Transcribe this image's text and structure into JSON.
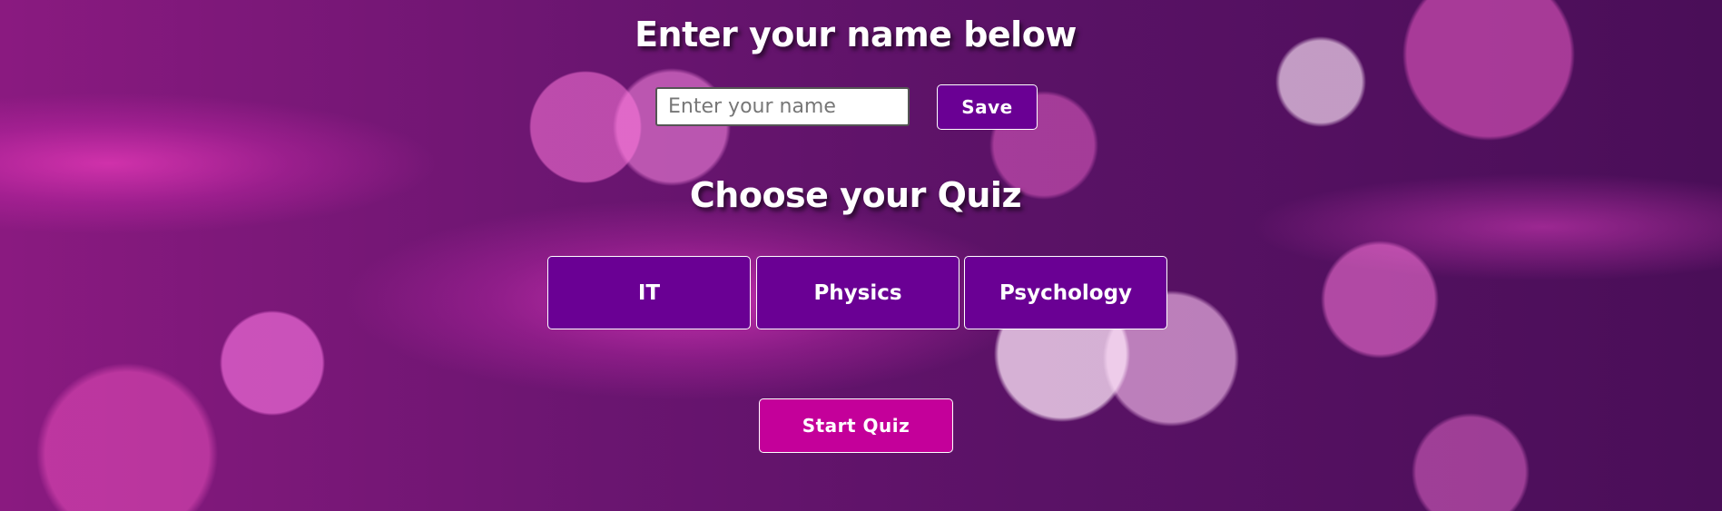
{
  "name_section": {
    "heading": "Enter your name below",
    "input_placeholder": "Enter your name",
    "input_value": "",
    "save_label": "Save"
  },
  "quiz_section": {
    "heading": "Choose your Quiz",
    "options": [
      {
        "label": "IT"
      },
      {
        "label": "Physics"
      },
      {
        "label": "Psychology"
      }
    ]
  },
  "start_label": "Start Quiz",
  "colors": {
    "button_purple": "#6a0094",
    "start_button": "#c4009a",
    "heading_text": "#ffffff"
  }
}
